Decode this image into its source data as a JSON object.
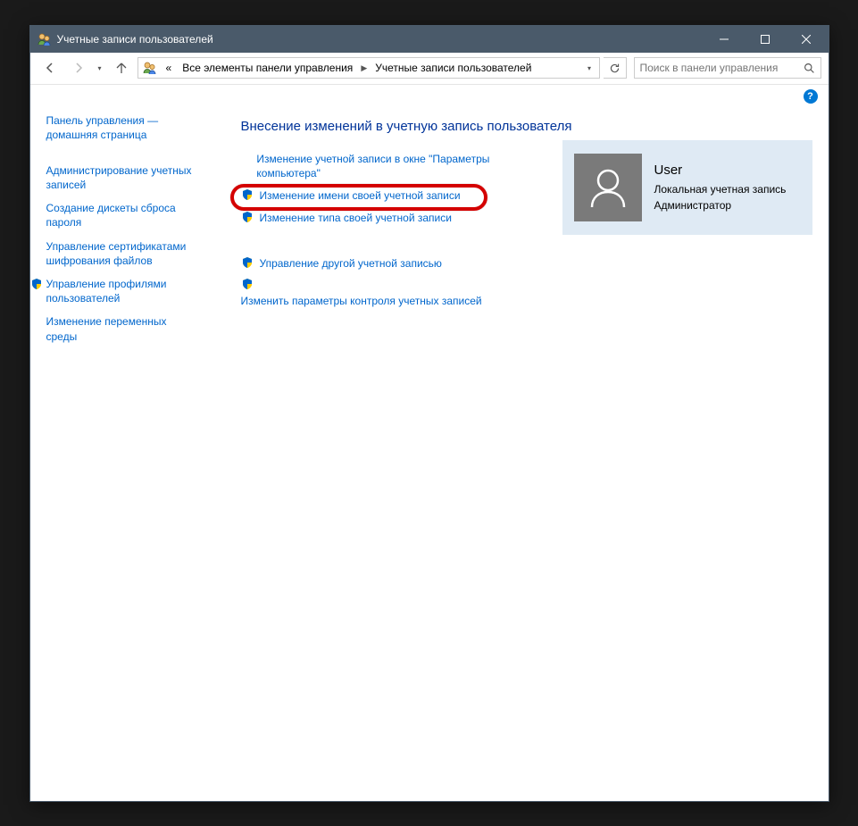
{
  "window": {
    "title": "Учетные записи пользователей"
  },
  "breadcrumb": {
    "prefix": "«",
    "items": [
      "Все элементы панели управления",
      "Учетные записи пользователей"
    ]
  },
  "search": {
    "placeholder": "Поиск в панели управления"
  },
  "sidebar": {
    "items": [
      {
        "label": "Панель управления — домашняя страница",
        "shield": false
      },
      {
        "label": "Администрирование учетных записей",
        "shield": false
      },
      {
        "label": "Создание дискеты сброса пароля",
        "shield": false
      },
      {
        "label": "Управление сертификатами шифрования файлов",
        "shield": false
      },
      {
        "label": "Управление профилями пользователей",
        "shield": true
      },
      {
        "label": "Изменение переменных среды",
        "shield": false
      }
    ]
  },
  "main": {
    "heading": "Внесение изменений в учетную запись пользователя",
    "actions_top": [
      {
        "label": "Изменение учетной записи в окне \"Параметры компьютера\"",
        "shield": false
      },
      {
        "label": "Изменение имени своей учетной записи",
        "shield": true
      },
      {
        "label": "Изменение типа своей учетной записи",
        "shield": true
      }
    ],
    "actions_bottom": [
      {
        "label": "Управление другой учетной записью",
        "shield": true
      },
      {
        "label": "Изменить параметры контроля учетных записей",
        "shield": true,
        "shield_above": true
      }
    ]
  },
  "user": {
    "name": "User",
    "type": "Локальная учетная запись",
    "role": "Администратор"
  }
}
